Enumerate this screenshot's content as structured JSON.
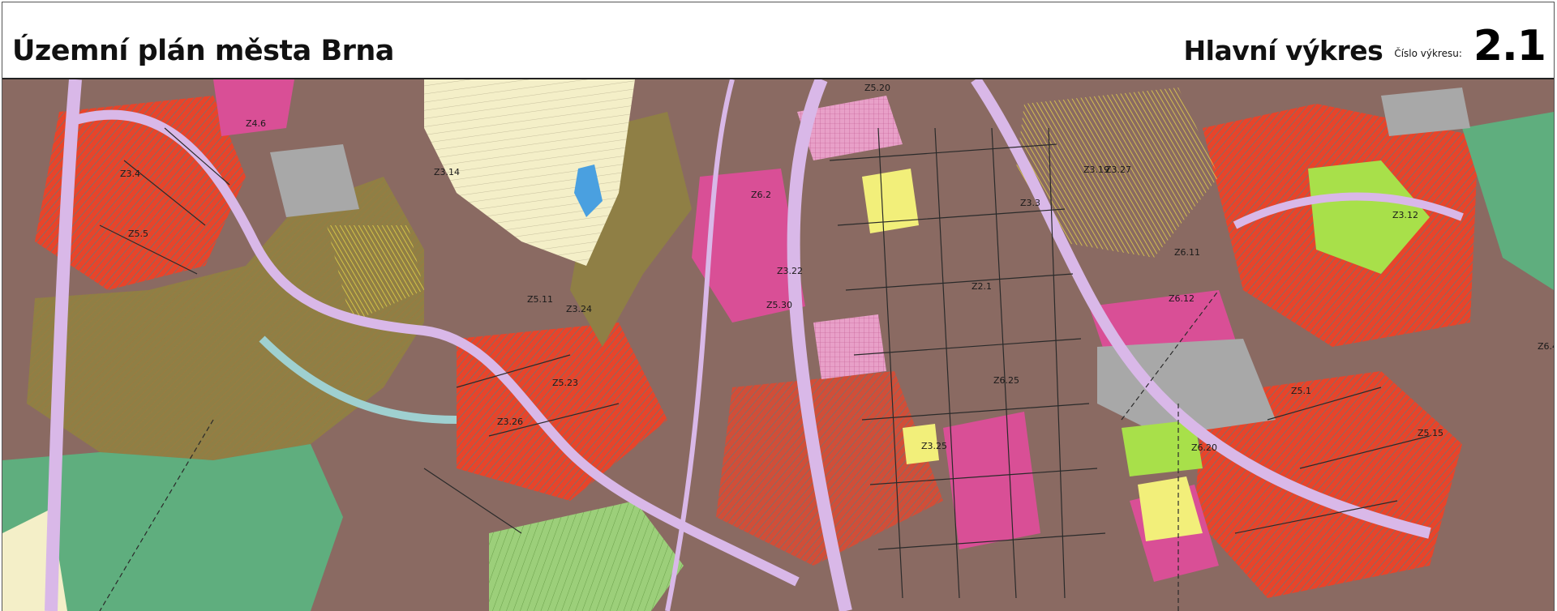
{
  "header": {
    "title": "Územní plán města Brna",
    "drawing_name": "Hlavní výkres",
    "drawing_number_label": "Číslo výkresu:",
    "drawing_number": "2.1"
  },
  "map": {
    "zone_labels": [
      "Z5.20",
      "Z3.27",
      "Z4.6",
      "Z3.4",
      "Z3.14",
      "Z5.5",
      "Z6.2",
      "Z3.3",
      "Z3.19",
      "Z3.12",
      "Z6.11",
      "Z3.22",
      "Z2.1",
      "Z5.11",
      "Z3.24",
      "Z5.30",
      "Z6.12",
      "Z5.23",
      "Z6.25",
      "Z6.20",
      "Z5.1",
      "Z5.15",
      "Z6.4",
      "Z3.26",
      "Z3.25"
    ],
    "colors": {
      "residential_brown": "#8a6a62",
      "mixed_red": "#e8442a",
      "commercial_magenta": "#d94f96",
      "forest_olive": "#8f7f45",
      "meadow_green": "#5fae7e",
      "park_lime": "#a8e04a",
      "agri_cream": "#f4efc8",
      "roads_lilac": "#d9b8e8",
      "industrial_grey": "#a8a8a8",
      "sport_yellow": "#f2ef7a",
      "water_blue": "#4aa0e0"
    }
  }
}
